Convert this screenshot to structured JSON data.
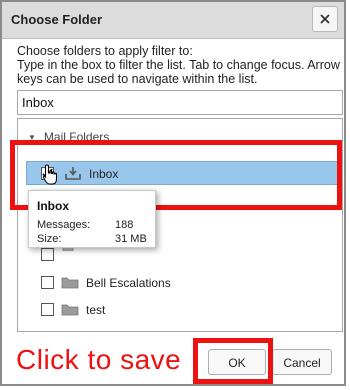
{
  "dialog": {
    "title": "Choose Folder",
    "instructions": "Choose folders to apply filter to:\nType in the box to filter the list. Tab to change focus. Arrow keys can be used to navigate within the list.",
    "filter_value": "Inbox"
  },
  "tree": {
    "header": "Mail Folders",
    "items": [
      {
        "label": "Inbox",
        "checked": true,
        "selected": true,
        "icon": "inbox-download-icon"
      },
      {
        "label": "",
        "checked": false,
        "icon": "trash-icon"
      },
      {
        "label": "Bell Escalations",
        "checked": false,
        "icon": "folder-icon"
      },
      {
        "label": "test",
        "checked": false,
        "icon": "folder-icon"
      }
    ]
  },
  "tooltip": {
    "title": "Inbox",
    "messages_label": "Messages:",
    "messages_value": "188",
    "size_label": "Size:",
    "size_value": "31 MB"
  },
  "annotation": {
    "text": "Click to save",
    "color": "#ee1111"
  },
  "buttons": {
    "ok": "OK",
    "cancel": "Cancel"
  },
  "colors": {
    "selection": "#99c7ec",
    "highlight": "#ee1111",
    "titlebar": "#dcdcdc"
  }
}
